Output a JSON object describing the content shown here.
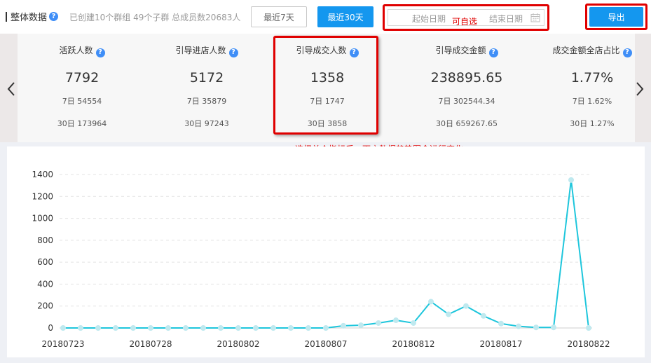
{
  "header": {
    "title": "整体数据",
    "help_glyph": "?",
    "summary": "已创建10个群组 49个子群 总成员数20683人",
    "btn_last7": "最近7天",
    "btn_last30": "最近30天",
    "date_start_placeholder": "起始日期",
    "date_end_placeholder": "结束日期",
    "annotation_custom": "可自选",
    "btn_export": "导出"
  },
  "metrics": [
    {
      "label": "活跃人数",
      "value": "7792",
      "d7": "7日 54554",
      "d30": "30日 173964"
    },
    {
      "label": "引导进店人数",
      "value": "5172",
      "d7": "7日 35879",
      "d30": "30日 97243"
    },
    {
      "label": "引导成交人数",
      "value": "1358",
      "d7": "7日 1747",
      "d30": "30日 3858"
    },
    {
      "label": "引导成交金额",
      "value": "238895.65",
      "d7": "7日 302544.34",
      "d30": "30日 659267.65"
    },
    {
      "label": "成交金额全店占比",
      "value": "1.77%",
      "d7": "7日 1.62%",
      "d30": "30日 1.27%"
    }
  ],
  "annotation_trend": "选择单个指标后，下方数据趋势图会进行变化",
  "colors": {
    "accent": "#1497ef",
    "annotation": "#e00000",
    "line": "#1ec6dc",
    "point": "#bfe9ef"
  },
  "chart_data": {
    "type": "line",
    "x": [
      "20180723",
      "20180724",
      "20180725",
      "20180726",
      "20180727",
      "20180728",
      "20180729",
      "20180730",
      "20180731",
      "20180801",
      "20180802",
      "20180803",
      "20180804",
      "20180805",
      "20180806",
      "20180807",
      "20180808",
      "20180809",
      "20180810",
      "20180811",
      "20180812",
      "20180813",
      "20180814",
      "20180815",
      "20180816",
      "20180817",
      "20180818",
      "20180819",
      "20180820",
      "20180821",
      "20180822"
    ],
    "x_tick_labels": [
      "20180723",
      "20180728",
      "20180802",
      "20180807",
      "20180812",
      "20180817",
      "20180822"
    ],
    "y_ticks": [
      "0",
      "200",
      "400",
      "600",
      "800",
      "1000",
      "1200",
      "1400"
    ],
    "ylim": [
      0,
      1400
    ],
    "series": [
      {
        "values": [
          0,
          0,
          0,
          0,
          0,
          0,
          0,
          0,
          0,
          0,
          0,
          0,
          0,
          0,
          0,
          0,
          20,
          25,
          45,
          70,
          45,
          240,
          125,
          200,
          110,
          40,
          15,
          5,
          5,
          1350,
          0
        ]
      }
    ],
    "grid": true,
    "legend": "none"
  }
}
